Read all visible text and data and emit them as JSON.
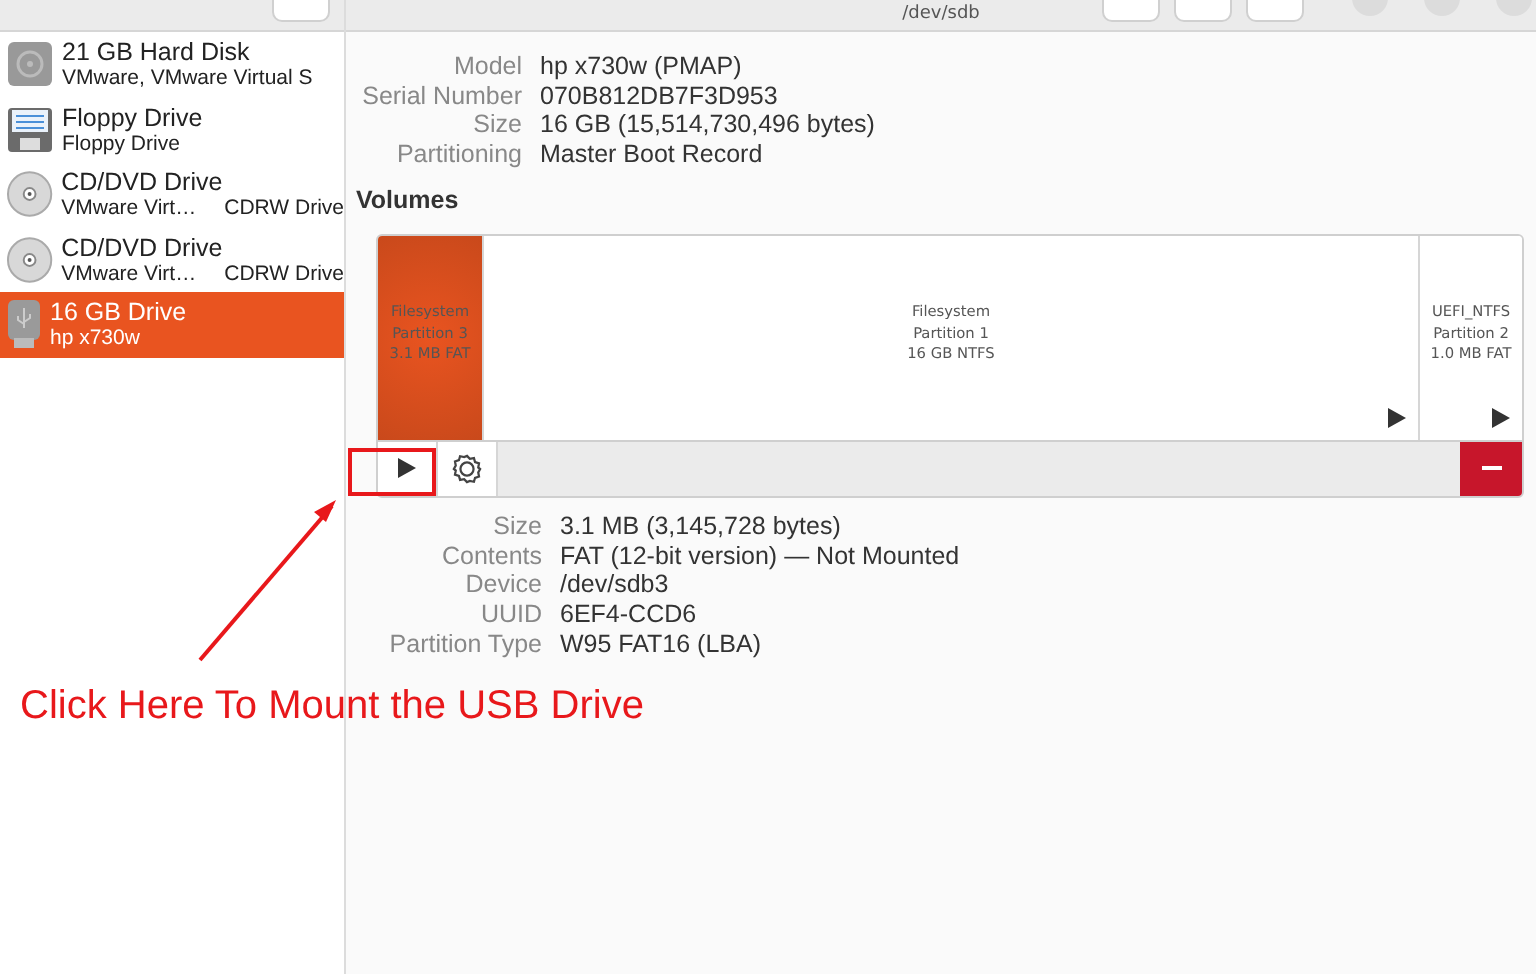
{
  "window": {
    "title": "/dev/sdb"
  },
  "sidebar": {
    "items": [
      {
        "kind": "hdd",
        "title": "21 GB Hard Disk",
        "subtitle": "VMware, VMware Virtual S",
        "selected": false
      },
      {
        "kind": "floppy",
        "title": "Floppy Drive",
        "subtitle": "Floppy Drive",
        "selected": false
      },
      {
        "kind": "optical",
        "title": "CD/DVD Drive",
        "subtitle": "VMware Virt…",
        "media": "CDRW Drive",
        "selected": false
      },
      {
        "kind": "optical",
        "title": "CD/DVD Drive",
        "subtitle": "VMware Virt…",
        "media": "CDRW Drive",
        "selected": false
      },
      {
        "kind": "usb",
        "title": "16 GB Drive",
        "subtitle": "hp x730w",
        "selected": true
      }
    ]
  },
  "drive": [
    {
      "label": "Model",
      "value": "hp x730w (PMAP)"
    },
    {
      "label": "Serial Number",
      "value": "070B812DB7F3D953"
    },
    {
      "label": "Size",
      "value": "16 GB (15,514,730,496 bytes)"
    },
    {
      "label": "Partitioning",
      "value": "Master Boot Record"
    }
  ],
  "volumes": {
    "heading": "Volumes",
    "segments": [
      {
        "lines": [
          "Filesystem",
          "Partition 3",
          "3.1 MB FAT"
        ],
        "selected": true
      },
      {
        "lines": [
          "Filesystem",
          "Partition 1",
          "16 GB NTFS"
        ],
        "selected": false
      },
      {
        "lines": [
          "UEFI_NTFS",
          "Partition 2",
          "1.0 MB FAT"
        ],
        "selected": false
      }
    ]
  },
  "partition": [
    {
      "label": "Size",
      "value": "3.1 MB (3,145,728 bytes)"
    },
    {
      "label": "Contents",
      "value": "FAT (12-bit version) — Not Mounted"
    },
    {
      "label": "Device",
      "value": "/dev/sdb3"
    },
    {
      "label": "UUID",
      "value": "6EF4-CCD6"
    },
    {
      "label": "Partition Type",
      "value": "W95 FAT16 (LBA)"
    }
  ],
  "annotation": {
    "text": "Click Here To Mount the USB Drive"
  }
}
